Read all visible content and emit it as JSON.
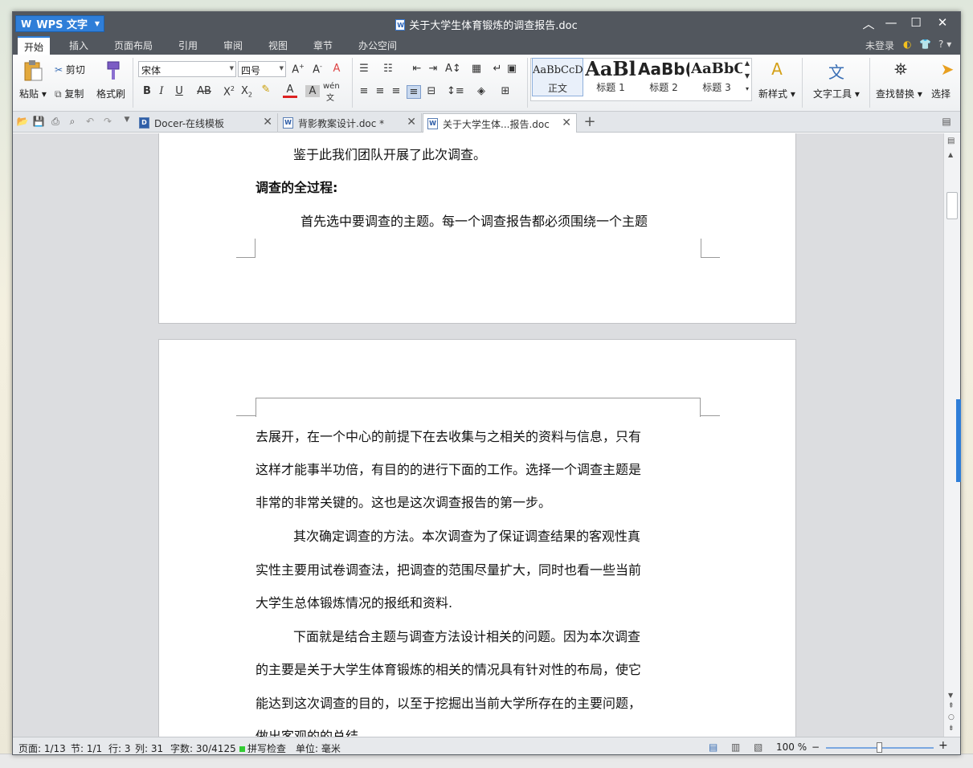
{
  "window": {
    "app_name": "WPS 文字",
    "doc_title": "关于大学生体育锻炼的调查报告.doc"
  },
  "menu": {
    "items": [
      "开始",
      "插入",
      "页面布局",
      "引用",
      "审阅",
      "视图",
      "章节",
      "办公空间"
    ],
    "active": "开始",
    "login": "未登录",
    "help": "?"
  },
  "ribbon": {
    "paste": "粘贴",
    "cut": "剪切",
    "copy": "复制",
    "format_painter": "格式刷",
    "font_name": "宋体",
    "font_size": "四号",
    "styles": [
      {
        "preview": "AaBbCcDc",
        "label": "正文"
      },
      {
        "preview": "AaBl",
        "label": "标题 1"
      },
      {
        "preview": "AaBb(",
        "label": "标题 2"
      },
      {
        "preview": "AaBbC",
        "label": "标题 3"
      }
    ],
    "new_style": "新样式",
    "text_tools": "文字工具",
    "find_replace": "查找替换",
    "select": "选择"
  },
  "tabs": [
    {
      "label": "Docer-在线模板",
      "active": false
    },
    {
      "label": "背影教案设计.doc *",
      "active": false
    },
    {
      "label": "关于大学生体...报告.doc",
      "active": true
    }
  ],
  "document": {
    "page1_lines": [
      "鉴于此我们团队开展了此次调查。",
      "调查的全过程:",
      "首先选中要调查的主题。每一个调查报告都必须围绕一个主题"
    ],
    "page2_lines": [
      "去展开，在一个中心的前提下在去收集与之相关的资料与信息，只有",
      "这样才能事半功倍，有目的的进行下面的工作。选择一个调查主题是",
      "非常的非常关键的。这也是这次调查报告的第一步。",
      "其次确定调查的方法。本次调查为了保证调查结果的客观性真",
      "实性主要用试卷调查法，把调查的范围尽量扩大，同时也看一些当前",
      "大学生总体锻炼情况的报纸和资料.",
      "下面就是结合主题与调查方法设计相关的问题。因为本次调查",
      "的主要是关于大学生体育锻炼的相关的情况具有针对性的布局，使它",
      "能达到这次调查的目的，以至于挖掘出当前大学所存在的主要问题，",
      "做出客观的的总结。"
    ]
  },
  "status": {
    "page": "页面: 1/13",
    "section": "节: 1/1",
    "row": "行: 3",
    "col": "列: 31",
    "words": "字数: 30/4125",
    "spell": "拼写检查",
    "unit": "单位: 毫米",
    "zoom": "100 %"
  },
  "colors": {
    "titlebar": "#52575e",
    "accent": "#2f7ed8"
  }
}
